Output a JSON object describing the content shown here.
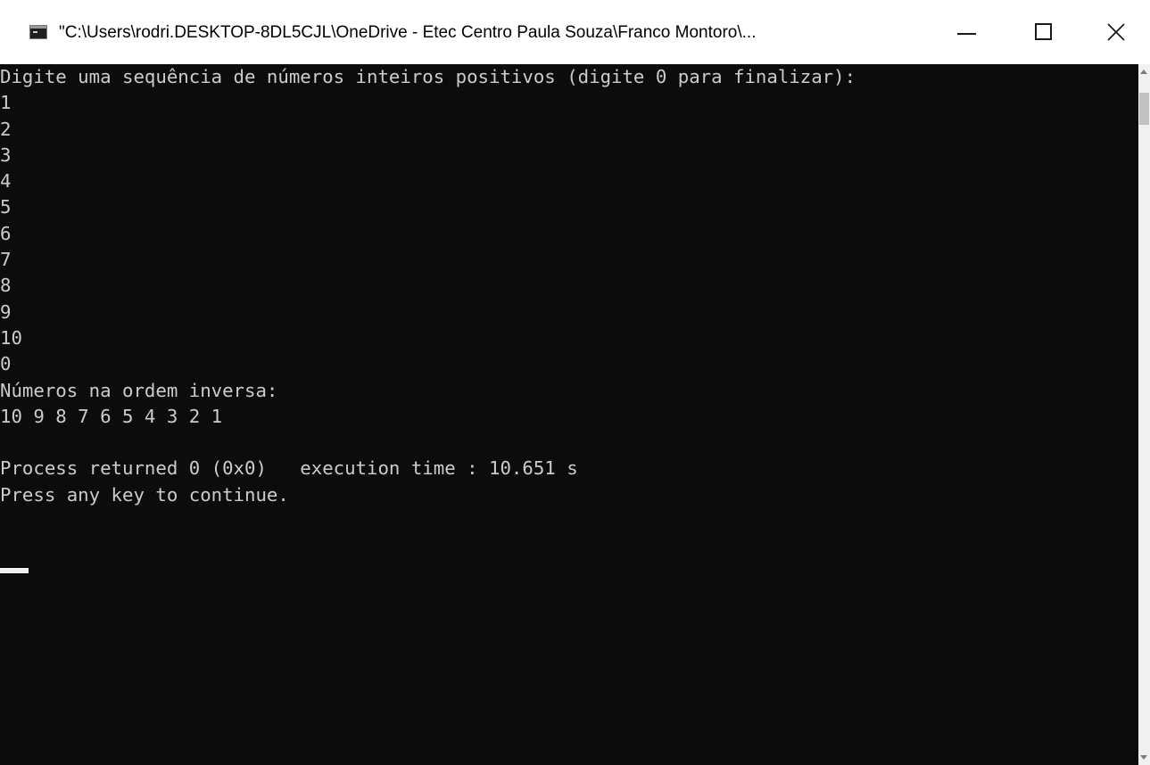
{
  "window": {
    "title": "\"C:\\Users\\rodri.DESKTOP-8DL5CJL\\OneDrive - Etec Centro Paula Souza\\Franco Montoro\\...",
    "icon": "console-app-icon",
    "controls": {
      "minimize_icon": "minimize-icon",
      "maximize_icon": "maximize-icon",
      "close_icon": "close-icon"
    }
  },
  "console": {
    "lines": [
      "Digite uma sequência de números inteiros positivos (digite 0 para finalizar):",
      "1",
      "2",
      "3",
      "4",
      "5",
      "6",
      "7",
      "8",
      "9",
      "10",
      "0",
      "Números na ordem inversa:",
      "10 9 8 7 6 5 4 3 2 1 ",
      "",
      "Process returned 0 (0x0)   execution time : 10.651 s",
      "Press any key to continue."
    ]
  },
  "colors": {
    "console_background": "#0c0c0c",
    "console_text": "#cccccc",
    "titlebar_background": "#ffffff"
  }
}
